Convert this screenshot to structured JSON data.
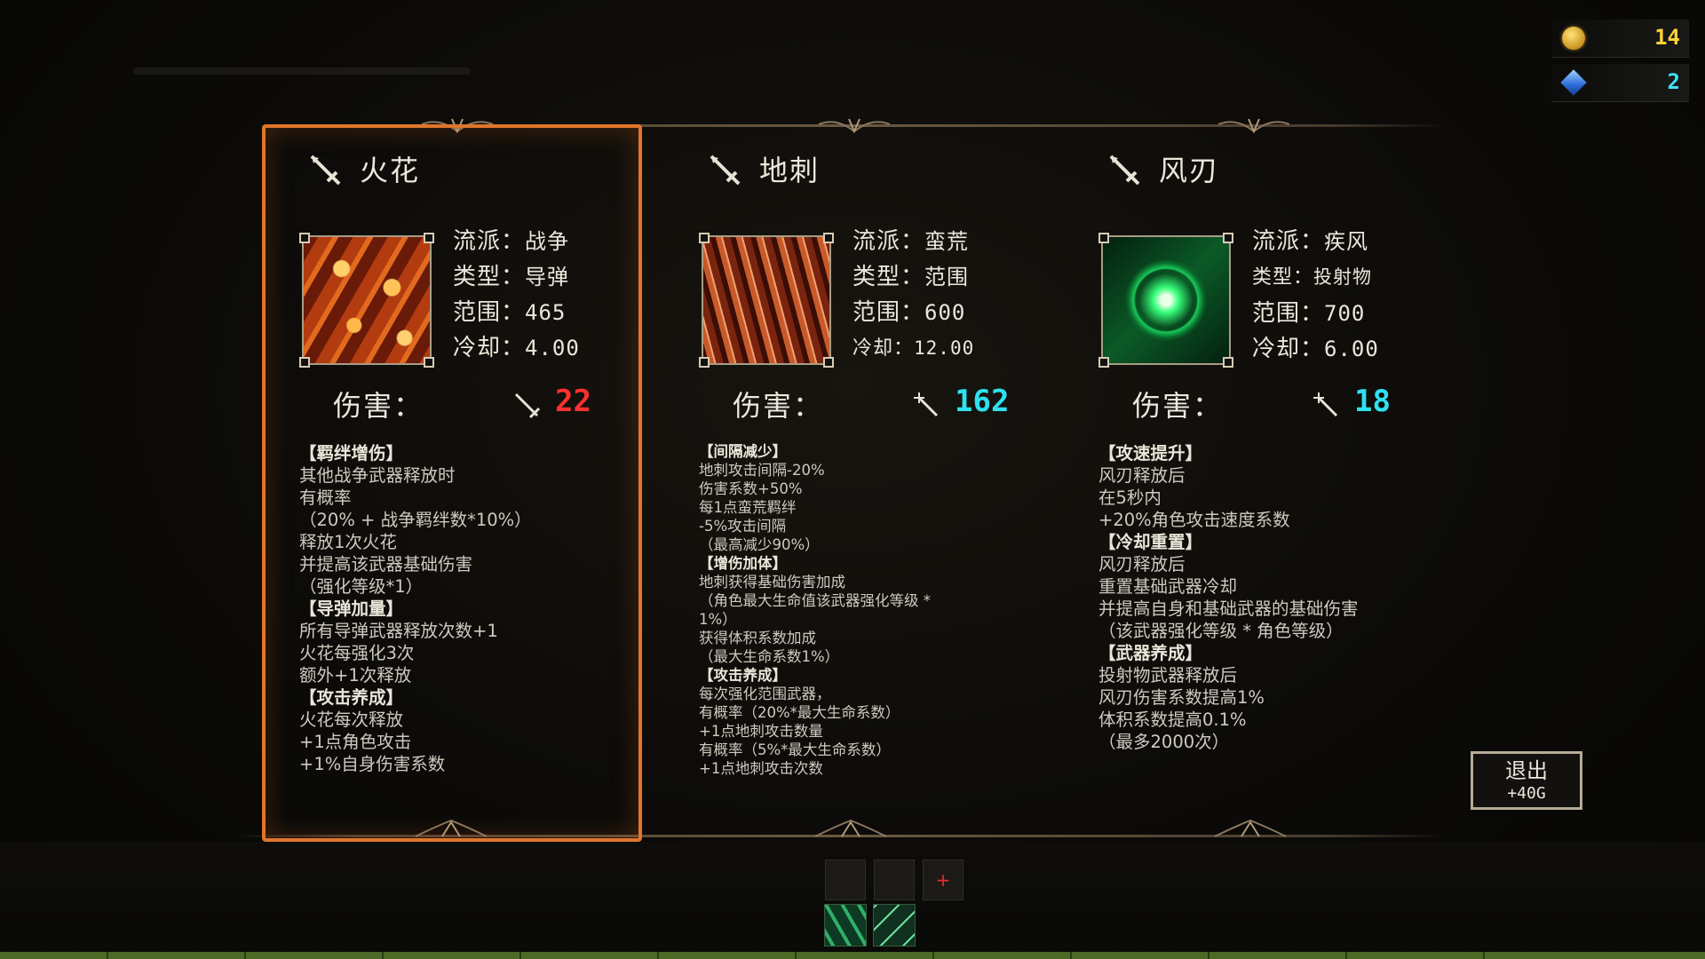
{
  "hud": {
    "gold": "14",
    "gems": "2",
    "gold_icon": "gold-coin-icon",
    "gem_icon": "blue-gem-icon"
  },
  "colors": {
    "selected_border": "#e0762c",
    "damage_red": "#ff3030",
    "damage_cyan": "#2fe0f0",
    "gold_text": "#ffd23a",
    "gem_text": "#3ee0ff"
  },
  "cards": [
    {
      "name": "火花",
      "selected": true,
      "stats": [
        {
          "k": "流派：",
          "v": "战争"
        },
        {
          "k": "类型：",
          "v": "导弹"
        },
        {
          "k": "范围：",
          "v": "465"
        },
        {
          "k": "冷却：",
          "v": "4.00"
        }
      ],
      "damage_label": "伤害：",
      "damage_value": "22",
      "damage_icon": "sword-slash-icon",
      "desc": [
        "【羁绊增伤】",
        "其他战争武器释放时",
        "有概率",
        "（20% + 战争羁绊数*10%）",
        "释放1次火花",
        "并提高该武器基础伤害",
        "（强化等级*1）",
        "【导弹加量】",
        "所有导弹武器释放次数+1",
        "火花每强化3次",
        "额外+1次释放",
        "【攻击养成】",
        "火花每次释放",
        "+1点角色攻击",
        "+1%自身伤害系数"
      ]
    },
    {
      "name": "地刺",
      "selected": false,
      "stats": [
        {
          "k": "流派：",
          "v": "蛮荒"
        },
        {
          "k": "类型：",
          "v": "范围"
        },
        {
          "k": "范围：",
          "v": "600"
        },
        {
          "k": "冷却：",
          "v": "12.00"
        }
      ],
      "damage_label": "伤害：",
      "damage_value": "162",
      "damage_icon": "magic-wand-icon",
      "desc": [
        "【间隔减少】",
        "地刺攻击间隔-20%",
        "伤害系数+50%",
        "每1点蛮荒羁绊",
        "-5%攻击间隔",
        "（最高减少90%）",
        "【增伤加体】",
        "地刺获得基础伤害加成",
        "（角色最大生命值该武器强化等级 *",
        "1%）",
        "获得体积系数加成",
        "（最大生命系数1%）",
        "【攻击养成】",
        "每次强化范围武器，",
        "有概率（20%*最大生命系数）",
        "+1点地刺攻击数量",
        "有概率（5%*最大生命系数）",
        "+1点地刺攻击次数"
      ]
    },
    {
      "name": "风刃",
      "selected": false,
      "stats": [
        {
          "k": "流派：",
          "v": "疾风"
        },
        {
          "k": "类型：",
          "v": "投射物"
        },
        {
          "k": "范围：",
          "v": "700"
        },
        {
          "k": "冷却：",
          "v": "6.00"
        }
      ],
      "damage_label": "伤害：",
      "damage_value": "18",
      "damage_icon": "magic-wand-icon",
      "desc": [
        "【攻速提升】",
        "风刃释放后",
        "在5秒内",
        "+20%角色攻击速度系数",
        "【冷却重置】",
        "风刃释放后",
        "重置基础武器冷却",
        "并提高自身和基础武器的基础伤害",
        "（该武器强化等级 * 角色等级）",
        "【武器养成】",
        "投射物武器释放后",
        "风刃伤害系数提高1%",
        "体积系数提高0.1%",
        "（最多2000次）"
      ]
    }
  ],
  "exit_button": {
    "label": "退出",
    "reward": "+40G"
  },
  "bottom": {
    "add_slot": "+"
  }
}
